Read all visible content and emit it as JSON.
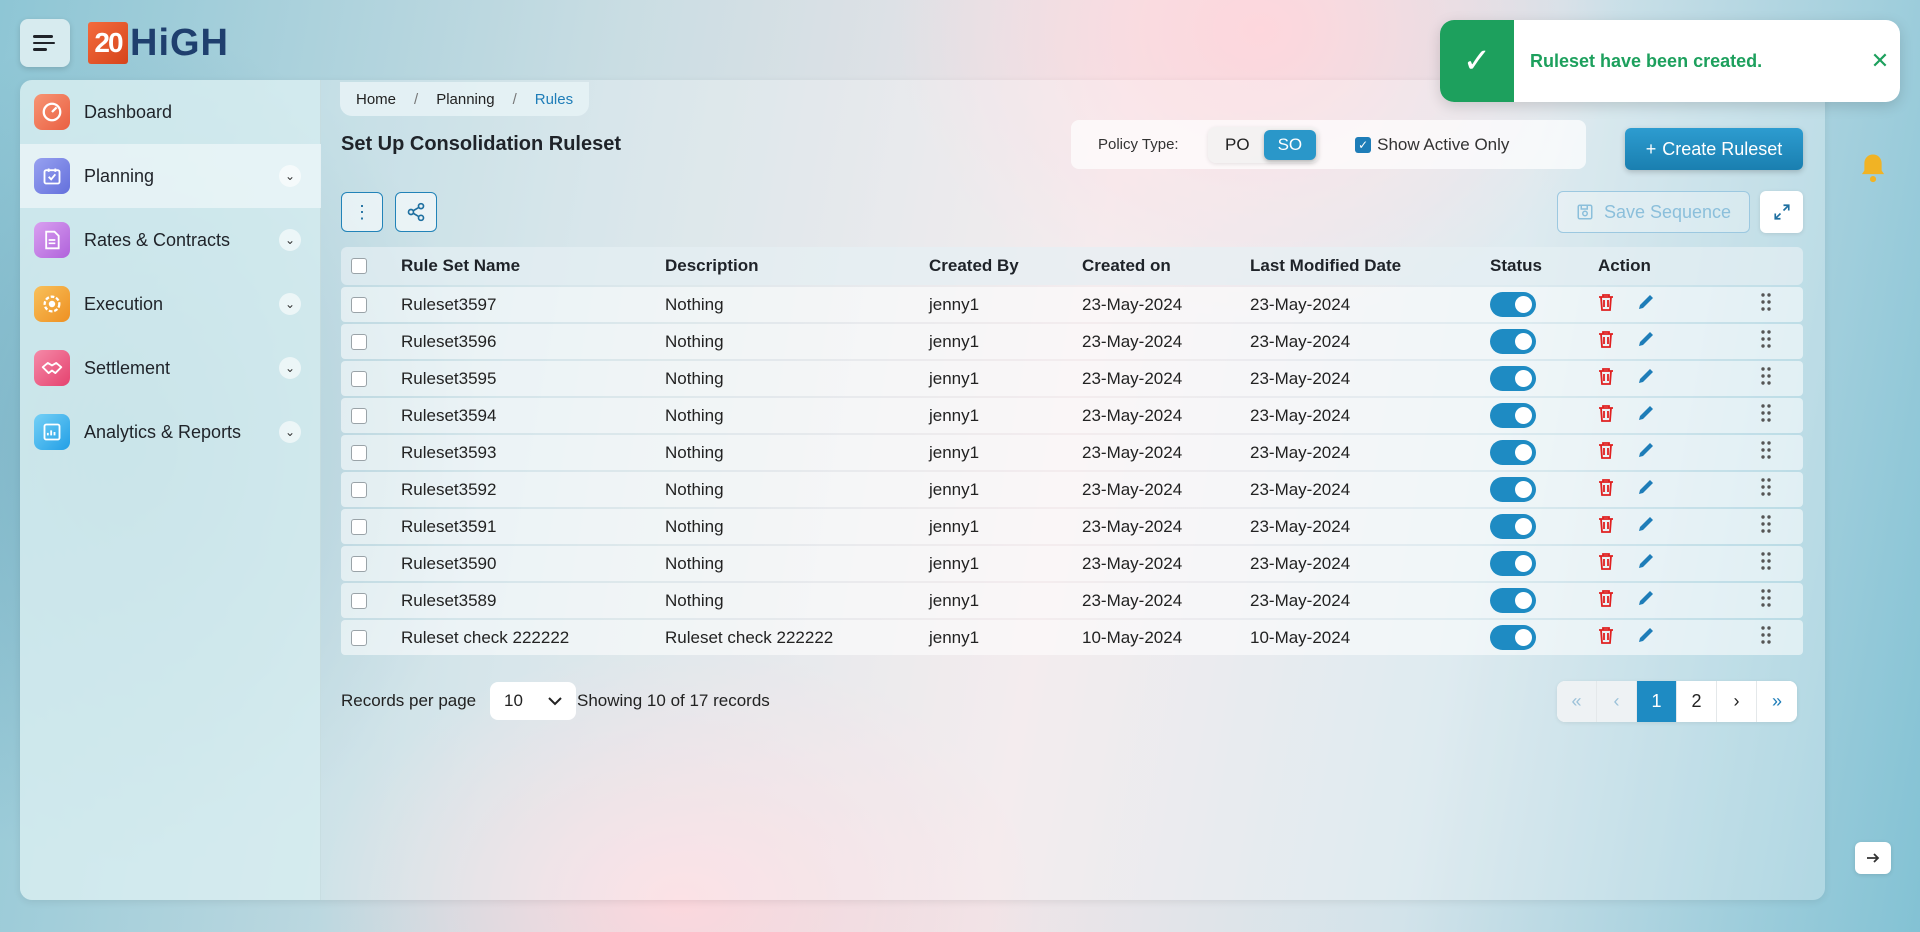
{
  "brand": {
    "logo_number": "20",
    "logo_text": "HiGH"
  },
  "sidebar": {
    "items": [
      {
        "label": "Dashboard",
        "icon": "dashboard-gauge-icon",
        "color": "#f07a5b",
        "expandable": false
      },
      {
        "label": "Planning",
        "icon": "calendar-check-icon",
        "color": "#7b86e8",
        "expandable": true
      },
      {
        "label": "Rates & Contracts",
        "icon": "document-icon",
        "color": "#c07ae0",
        "expandable": true
      },
      {
        "label": "Execution",
        "icon": "gear-dollar-icon",
        "color": "#f3a33b",
        "expandable": true
      },
      {
        "label": "Settlement",
        "icon": "handshake-icon",
        "color": "#ee5c8a",
        "expandable": true
      },
      {
        "label": "Analytics & Reports",
        "icon": "report-chart-icon",
        "color": "#3db4ee",
        "expandable": true
      }
    ]
  },
  "breadcrumb": {
    "home": "Home",
    "planning": "Planning",
    "current": "Rules",
    "sep": "/"
  },
  "page": {
    "title": "Set Up Consolidation Ruleset"
  },
  "policy": {
    "label": "Policy Type:",
    "options": [
      "PO",
      "SO"
    ],
    "selected": "SO",
    "show_active_label": "Show Active Only",
    "show_active_checked": true
  },
  "toolbar": {
    "create_label": "Create Ruleset",
    "save_sequence_label": "Save Sequence"
  },
  "table": {
    "headers": [
      "Rule Set Name",
      "Description",
      "Created By",
      "Created on",
      "Last Modified Date",
      "Status",
      "Action"
    ],
    "rows": [
      {
        "name": "Ruleset3597",
        "description": "Nothing",
        "created_by": "jenny1",
        "created_on": "23-May-2024",
        "modified": "23-May-2024",
        "active": true
      },
      {
        "name": "Ruleset3596",
        "description": "Nothing",
        "created_by": "jenny1",
        "created_on": "23-May-2024",
        "modified": "23-May-2024",
        "active": true
      },
      {
        "name": "Ruleset3595",
        "description": "Nothing",
        "created_by": "jenny1",
        "created_on": "23-May-2024",
        "modified": "23-May-2024",
        "active": true
      },
      {
        "name": "Ruleset3594",
        "description": "Nothing",
        "created_by": "jenny1",
        "created_on": "23-May-2024",
        "modified": "23-May-2024",
        "active": true
      },
      {
        "name": "Ruleset3593",
        "description": "Nothing",
        "created_by": "jenny1",
        "created_on": "23-May-2024",
        "modified": "23-May-2024",
        "active": true
      },
      {
        "name": "Ruleset3592",
        "description": "Nothing",
        "created_by": "jenny1",
        "created_on": "23-May-2024",
        "modified": "23-May-2024",
        "active": true
      },
      {
        "name": "Ruleset3591",
        "description": "Nothing",
        "created_by": "jenny1",
        "created_on": "23-May-2024",
        "modified": "23-May-2024",
        "active": true
      },
      {
        "name": "Ruleset3590",
        "description": "Nothing",
        "created_by": "jenny1",
        "created_on": "23-May-2024",
        "modified": "23-May-2024",
        "active": true
      },
      {
        "name": "Ruleset3589",
        "description": "Nothing",
        "created_by": "jenny1",
        "created_on": "23-May-2024",
        "modified": "23-May-2024",
        "active": true
      },
      {
        "name": "Ruleset check 222222",
        "description": "Ruleset check 222222",
        "created_by": "jenny1",
        "created_on": "10-May-2024",
        "modified": "10-May-2024",
        "active": true
      }
    ]
  },
  "footer": {
    "records_per_page_label": "Records per page",
    "records_per_page_value": "10",
    "showing_text": "Showing 10 of 17 records",
    "pages": [
      "1",
      "2"
    ],
    "current_page": "1"
  },
  "toast": {
    "message": "Ruleset have been created.",
    "status_color": "#1da05d"
  },
  "colors": {
    "accent": "#1e8bc3",
    "danger": "#e02020",
    "success": "#1da05d"
  }
}
